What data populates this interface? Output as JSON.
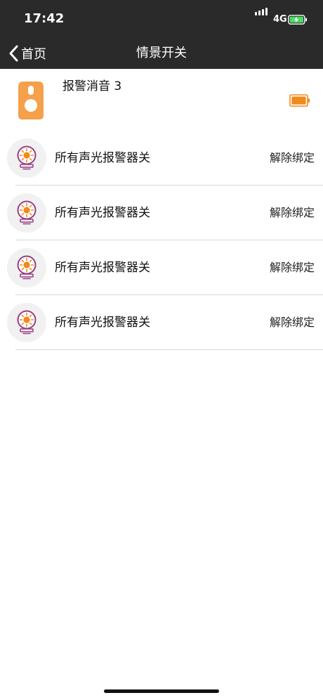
{
  "status_bar": {
    "time": "17:42",
    "network": "4G",
    "icons": [
      "signal-icon",
      "battery-charging-icon"
    ]
  },
  "nav": {
    "back_label": "首页",
    "title": "情景开关",
    "back_icon": "chevron-left-icon"
  },
  "device": {
    "name": "报警消音 3",
    "icon": "key-fob-icon",
    "status_icon": "battery-full-icon"
  },
  "items": [
    {
      "label": "所有声光报警器关",
      "action": "解除绑定",
      "icon": "siren-light-icon"
    },
    {
      "label": "所有声光报警器关",
      "action": "解除绑定",
      "icon": "siren-light-icon"
    },
    {
      "label": "所有声光报警器关",
      "action": "解除绑定",
      "icon": "siren-light-icon"
    },
    {
      "label": "所有声光报警器关",
      "action": "解除绑定",
      "icon": "siren-light-icon"
    }
  ],
  "colors": {
    "bar_bg": "#2a2a2a",
    "accent_orange": "#f5a04a",
    "battery_orange": "#f08a1c",
    "icon_purple": "#9b3d86",
    "battery_green": "#4cd964"
  }
}
